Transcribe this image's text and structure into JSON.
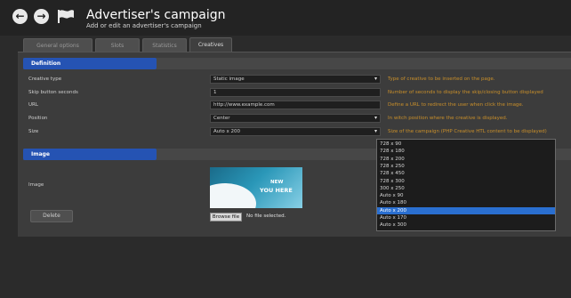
{
  "app": {
    "title": "Advertiser's campaign",
    "subtitle": "Add or edit an advertiser's campaign"
  },
  "nav": {
    "back_icon": "arrow-left-icon",
    "forward_icon": "arrow-right-icon",
    "flag_icon": "flag-icon",
    "back_glyph": "←",
    "forward_glyph": "→"
  },
  "tabs": [
    {
      "label": "General options",
      "active": false
    },
    {
      "label": "Slots",
      "active": false
    },
    {
      "label": "Statistics",
      "active": false
    },
    {
      "label": "Creatives",
      "active": true
    }
  ],
  "definition": {
    "header": "Definition",
    "fields": [
      {
        "label": "Creative type",
        "value": "Static image",
        "dropdown": true,
        "help": "Type of creative to be inserted on the page."
      },
      {
        "label": "Skip button seconds",
        "value": "1",
        "dropdown": false,
        "help": "Number of seconds to display the skip/closing button displayed"
      },
      {
        "label": "URL",
        "value": "http://www.example.com",
        "dropdown": false,
        "help": "Define a URL to redirect the user when click the image."
      },
      {
        "label": "Position",
        "value": "Center",
        "dropdown": true,
        "help": "In witch position where the creative is displayed."
      },
      {
        "label": "Size",
        "value": "Auto x 200",
        "dropdown": true,
        "help": "Size of the campaign (PHP Creative HTL content to be displayed)"
      }
    ]
  },
  "image_section": {
    "header": "Image",
    "label": "Image",
    "thumb_text1": "NEW",
    "thumb_text2": "YOU HERE",
    "browse_label": "Browse file",
    "file_status": "No file selected.",
    "delete_label": "Delete"
  },
  "size_dropdown": {
    "options": [
      "728 x 90",
      "728 x 180",
      "728 x 200",
      "728 x 250",
      "728 x 450",
      "728 x 300",
      "300 x 250",
      "Auto x 90",
      "Auto x 180",
      "Auto x 200",
      "Auto x 170",
      "Auto x 300"
    ],
    "selected_index": 9
  },
  "colors": {
    "section_header": "#2553b3",
    "help_text": "#c98f2a",
    "selected_option": "#2a6fd0"
  }
}
